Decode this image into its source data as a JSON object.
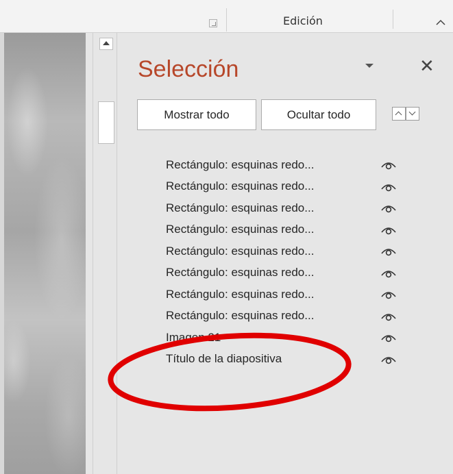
{
  "ribbon": {
    "group_label": "Edición"
  },
  "selection_pane": {
    "title": "Selección",
    "show_all_label": "Mostrar todo",
    "hide_all_label": "Ocultar todo",
    "objects": [
      "Rectángulo: esquinas redo...",
      "Rectángulo: esquinas redo...",
      "Rectángulo: esquinas redo...",
      "Rectángulo: esquinas redo...",
      "Rectángulo: esquinas redo...",
      "Rectángulo: esquinas redo...",
      "Rectángulo: esquinas redo...",
      "Rectángulo: esquinas redo...",
      "Imagen 21",
      "Título de la diapositiva"
    ]
  },
  "colors": {
    "pane_title": "#b7472a",
    "annotation": "#e00000"
  },
  "icons": {
    "visibility": "eye-icon",
    "close": "close-icon",
    "menu": "dropdown-icon",
    "collapse": "chevron-up-icon"
  }
}
